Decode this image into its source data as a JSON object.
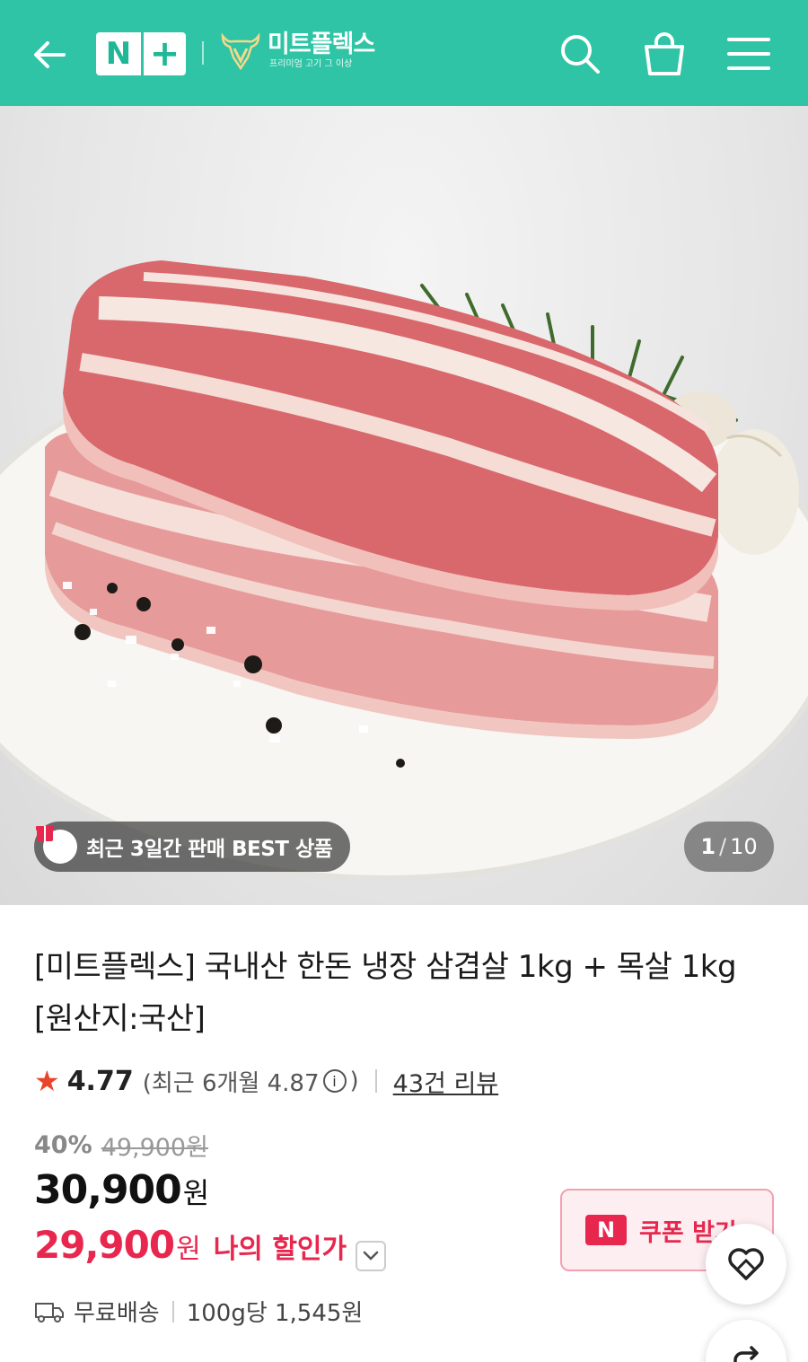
{
  "header": {
    "nplus_n": "N",
    "nplus_plus": "+",
    "brand_name": "미트플렉스",
    "brand_tagline": "프리미엄 고기 그 이상"
  },
  "icons": {
    "back": "back-arrow-icon",
    "search": "search-icon",
    "cart": "shopping-basket-icon",
    "menu": "hamburger-menu-icon",
    "gift": "gift-icon",
    "like": "heart-icon",
    "share": "share-icon",
    "truck": "truck-icon"
  },
  "gallery": {
    "badge_text": "최근 3일간 판매 BEST 상품",
    "current": "1",
    "total": "10"
  },
  "product": {
    "title": "[미트플렉스] 국내산 한돈 냉장 삼겹살 1kg + 목살 1kg [원산지:국산]",
    "rating": "4.77",
    "recent_rating_text": "(최근 6개월 4.87",
    "recent_rating_close": ")",
    "review_count": "43건 리뷰",
    "discount_pct": "40%",
    "original_price": "49,900원",
    "price": "30,900",
    "price_unit": "원",
    "my_price": "29,900",
    "my_price_unit": "원",
    "my_price_label": "나의 할인가",
    "coupon_label": "쿠폰 받기",
    "coupon_badge": "N",
    "shipping": "무료배송",
    "unit_price": "100g당 1,545원"
  },
  "colors": {
    "header_bg": "#2ec4a5",
    "accent_red": "#e8274f",
    "star": "#e8452c"
  }
}
